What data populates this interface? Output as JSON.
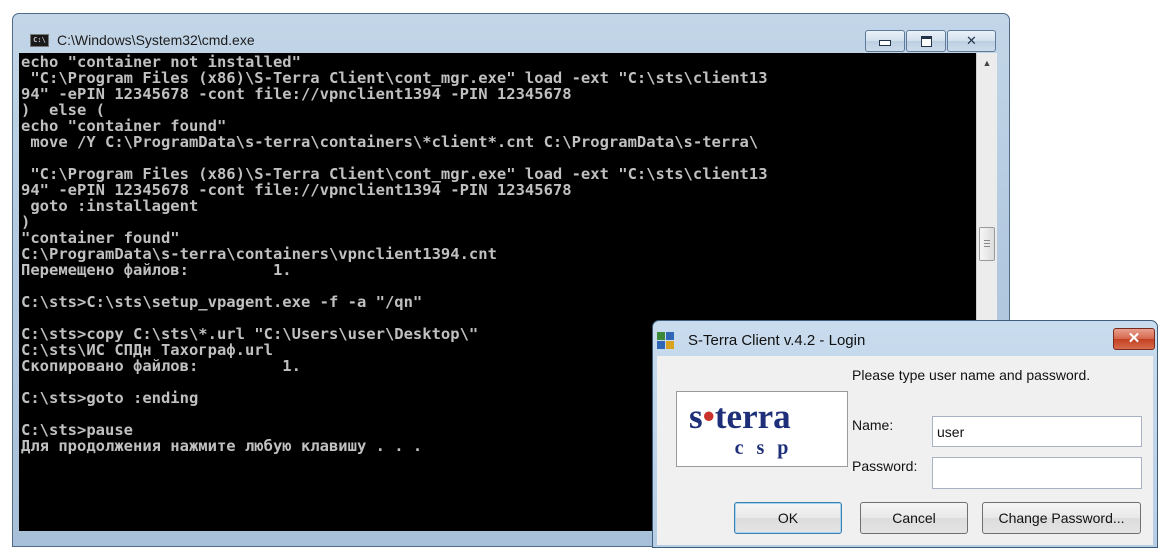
{
  "cmd": {
    "title": "C:\\Windows\\System32\\cmd.exe",
    "icon_text": "C:\\",
    "lines": [
      "echo \"container not installed\"",
      " \"C:\\Program Files (x86)\\S-Terra Client\\cont_mgr.exe\" load -ext \"C:\\sts\\client13",
      "94\" -ePIN 12345678 -cont file://vpnclient1394 -PIN 12345678",
      ")  else (",
      "echo \"container found\"",
      " move /Y C:\\ProgramData\\s-terra\\containers\\*client*.cnt C:\\ProgramData\\s-terra\\",
      "",
      " \"C:\\Program Files (x86)\\S-Terra Client\\cont_mgr.exe\" load -ext \"C:\\sts\\client13",
      "94\" -ePIN 12345678 -cont file://vpnclient1394 -PIN 12345678",
      " goto :installagent",
      ")",
      "\"container found\"",
      "C:\\ProgramData\\s-terra\\containers\\vpnclient1394.cnt",
      "Перемещено файлов:         1.",
      "",
      "C:\\sts>C:\\sts\\setup_vpagent.exe -f -a \"/qn\"",
      "",
      "C:\\sts>copy C:\\sts\\*.url \"C:\\Users\\user\\Desktop\\\"",
      "C:\\sts\\ИС СПДн Тахограф.url",
      "Скопировано файлов:         1.",
      "",
      "C:\\sts>goto :ending",
      "",
      "C:\\sts>pause",
      "Для продолжения нажмите любую клавишу . . ."
    ]
  },
  "login": {
    "title": "S-Terra Client v.4.2 - Login",
    "close_label": "✕",
    "prompt": "Please type user name and password.",
    "logo_top_left": "s",
    "logo_dot": "•",
    "logo_top_right": "terra",
    "logo_bottom": "csp",
    "name_label": "Name:",
    "name_value": "user",
    "password_label": "Password:",
    "password_value": "",
    "ok_label": "OK",
    "cancel_label": "Cancel",
    "change_password_label": "Change Password..."
  }
}
